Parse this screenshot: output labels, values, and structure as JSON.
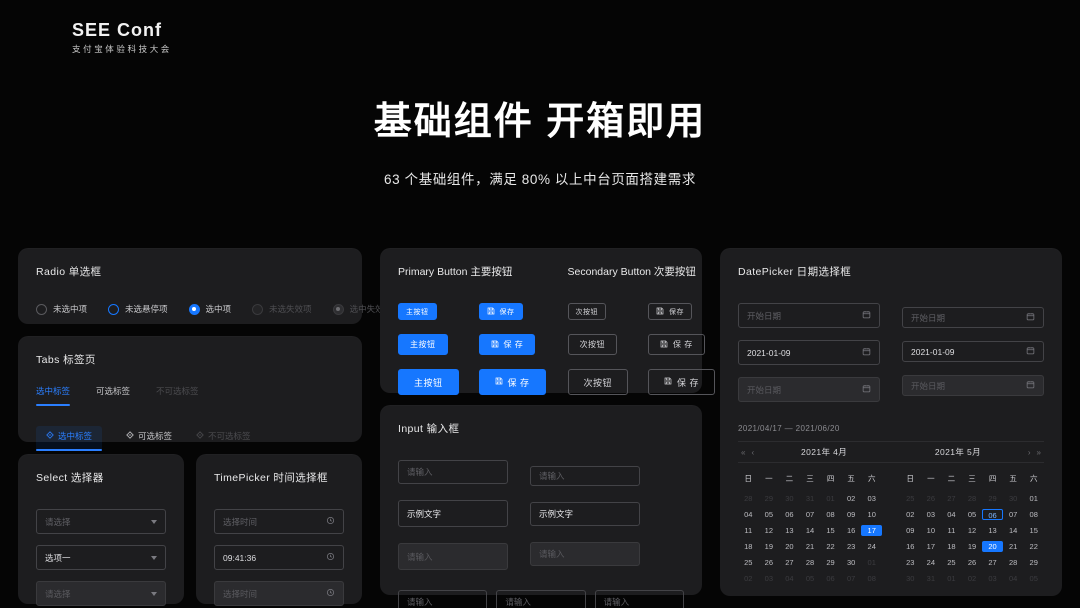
{
  "brand": {
    "title": "SEE Conf",
    "subtitle": "支付宝体验科技大会",
    "logo_icon": "see-conf-logo-icon"
  },
  "hero": {
    "title": "基础组件 开箱即用",
    "subtitle": "63 个基础组件，满足 80% 以上中台页面搭建需求"
  },
  "colors": {
    "accent": "#1677ff",
    "page_bg": "#050505",
    "card_bg": "#1d1d1f",
    "border": "#434347",
    "text": "#e9e9ea",
    "placeholder": "#5f5f64",
    "disabled_bg": "#2b2b2e"
  },
  "radio": {
    "title": "Radio 单选框",
    "items": [
      {
        "label": "未选中项",
        "state": "unchecked"
      },
      {
        "label": "未选悬停项",
        "state": "hover"
      },
      {
        "label": "选中项",
        "state": "checked"
      },
      {
        "label": "未选失效项",
        "state": "disabled"
      },
      {
        "label": "选中失效项",
        "state": "disabled-checked"
      }
    ]
  },
  "tabs": {
    "title": "Tabs 标签页",
    "row1": [
      {
        "label": "选中标签",
        "state": "active"
      },
      {
        "label": "可选标签",
        "state": "default"
      },
      {
        "label": "不可选标签",
        "state": "disabled"
      }
    ],
    "row2": [
      {
        "label": "选中标签",
        "state": "active",
        "icon": "diamond-icon"
      },
      {
        "label": "可选标签",
        "state": "default",
        "icon": "diamond-icon"
      },
      {
        "label": "不可选标签",
        "state": "disabled",
        "icon": "diamond-icon"
      }
    ]
  },
  "select": {
    "title": "Select 选择器",
    "fields": [
      {
        "value": "请选择",
        "state": "placeholder"
      },
      {
        "value": "选项一",
        "state": "filled"
      },
      {
        "value": "请选择",
        "state": "disabled"
      }
    ],
    "caret_icon": "chevron-down-icon"
  },
  "timepicker": {
    "title": "TimePicker 时间选择框",
    "fields": [
      {
        "value": "选择时间",
        "state": "placeholder"
      },
      {
        "value": "09:41:36",
        "state": "filled"
      },
      {
        "value": "选择时间",
        "state": "disabled"
      }
    ],
    "icon": "clock-icon"
  },
  "buttons": {
    "primary": {
      "title": "Primary Button 主要按钮",
      "plain": [
        "主按钮",
        "主按钮",
        "主按钮"
      ],
      "with_icon": [
        "保存",
        "保 存",
        "保 存"
      ],
      "icon": "save-icon"
    },
    "secondary": {
      "title": "Secondary Button 次要按钮",
      "plain": [
        "次按钮",
        "次按钮",
        "次按钮"
      ],
      "with_icon": [
        "保存",
        "保 存",
        "保 存"
      ],
      "icon": "save-icon"
    }
  },
  "input": {
    "title": "Input 输入框",
    "left": [
      {
        "value": "请输入",
        "state": "placeholder",
        "size": "md"
      },
      {
        "value": "示例文字",
        "state": "filled",
        "size": "lg"
      },
      {
        "value": "请输入",
        "state": "disabled",
        "size": "lg"
      }
    ],
    "right": [
      {
        "value": "请输入",
        "state": "placeholder",
        "size": "sm"
      },
      {
        "value": "示例文字",
        "state": "filled",
        "size": "md"
      },
      {
        "value": "请输入",
        "state": "disabled",
        "size": "md"
      }
    ],
    "bottom": [
      {
        "value": "请输入",
        "state": "placeholder"
      },
      {
        "value": "请输入",
        "state": "placeholder"
      },
      {
        "value": "请输入",
        "state": "placeholder"
      }
    ]
  },
  "datepicker": {
    "title": "DatePicker 日期选择框",
    "left": [
      {
        "value": "开始日期",
        "state": "placeholder",
        "size": "md"
      },
      {
        "value": "2021-01-09",
        "state": "filled",
        "size": "md"
      },
      {
        "value": "开始日期",
        "state": "disabled",
        "size": "md"
      }
    ],
    "right": [
      {
        "value": "开始日期",
        "state": "placeholder",
        "size": "sm"
      },
      {
        "value": "2021-01-09",
        "state": "filled",
        "size": "sm"
      },
      {
        "value": "开始日期",
        "state": "disabled",
        "size": "sm"
      }
    ],
    "calendar_icon": "calendar-icon",
    "calendar": {
      "range_text": "2021/04/17 — 2021/06/20",
      "weekdays": [
        "日",
        "一",
        "二",
        "三",
        "四",
        "五",
        "六"
      ],
      "nav": {
        "prev_year": "«",
        "prev_month": "‹",
        "next_month": "›",
        "next_year": "»"
      },
      "left_month": "2021年 4月",
      "right_month": "2021年 5月",
      "left_days": [
        {
          "n": "28",
          "out": true
        },
        {
          "n": "29",
          "out": true
        },
        {
          "n": "30",
          "out": true
        },
        {
          "n": "31",
          "out": true
        },
        {
          "n": "01",
          "out": true
        },
        {
          "n": "02"
        },
        {
          "n": "03"
        },
        {
          "n": "04"
        },
        {
          "n": "05"
        },
        {
          "n": "06"
        },
        {
          "n": "07"
        },
        {
          "n": "08"
        },
        {
          "n": "09"
        },
        {
          "n": "10"
        },
        {
          "n": "11"
        },
        {
          "n": "12"
        },
        {
          "n": "13"
        },
        {
          "n": "14"
        },
        {
          "n": "15"
        },
        {
          "n": "16"
        },
        {
          "n": "17",
          "sel": true
        },
        {
          "n": "18"
        },
        {
          "n": "19"
        },
        {
          "n": "20"
        },
        {
          "n": "21"
        },
        {
          "n": "22"
        },
        {
          "n": "23"
        },
        {
          "n": "24"
        },
        {
          "n": "25"
        },
        {
          "n": "26"
        },
        {
          "n": "27"
        },
        {
          "n": "28"
        },
        {
          "n": "29"
        },
        {
          "n": "30"
        },
        {
          "n": "01",
          "out": true
        },
        {
          "n": "02",
          "out": true
        },
        {
          "n": "03",
          "out": true
        },
        {
          "n": "04",
          "out": true
        },
        {
          "n": "05",
          "out": true
        },
        {
          "n": "06",
          "out": true
        },
        {
          "n": "07",
          "out": true
        },
        {
          "n": "08",
          "out": true
        }
      ],
      "right_days": [
        {
          "n": "25",
          "out": true
        },
        {
          "n": "26",
          "out": true
        },
        {
          "n": "27",
          "out": true
        },
        {
          "n": "28",
          "out": true
        },
        {
          "n": "29",
          "out": true
        },
        {
          "n": "30",
          "out": true
        },
        {
          "n": "01"
        },
        {
          "n": "02"
        },
        {
          "n": "03"
        },
        {
          "n": "04"
        },
        {
          "n": "05"
        },
        {
          "n": "06",
          "today": true
        },
        {
          "n": "07"
        },
        {
          "n": "08"
        },
        {
          "n": "09"
        },
        {
          "n": "10"
        },
        {
          "n": "11"
        },
        {
          "n": "12"
        },
        {
          "n": "13"
        },
        {
          "n": "14"
        },
        {
          "n": "15"
        },
        {
          "n": "16"
        },
        {
          "n": "17"
        },
        {
          "n": "18"
        },
        {
          "n": "19"
        },
        {
          "n": "20",
          "sel": true
        },
        {
          "n": "21"
        },
        {
          "n": "22"
        },
        {
          "n": "23"
        },
        {
          "n": "24"
        },
        {
          "n": "25"
        },
        {
          "n": "26"
        },
        {
          "n": "27"
        },
        {
          "n": "28"
        },
        {
          "n": "29"
        },
        {
          "n": "30",
          "out": true
        },
        {
          "n": "31",
          "out": true
        },
        {
          "n": "01",
          "out": true
        },
        {
          "n": "02",
          "out": true
        },
        {
          "n": "03",
          "out": true
        },
        {
          "n": "04",
          "out": true
        },
        {
          "n": "05",
          "out": true
        }
      ]
    }
  }
}
